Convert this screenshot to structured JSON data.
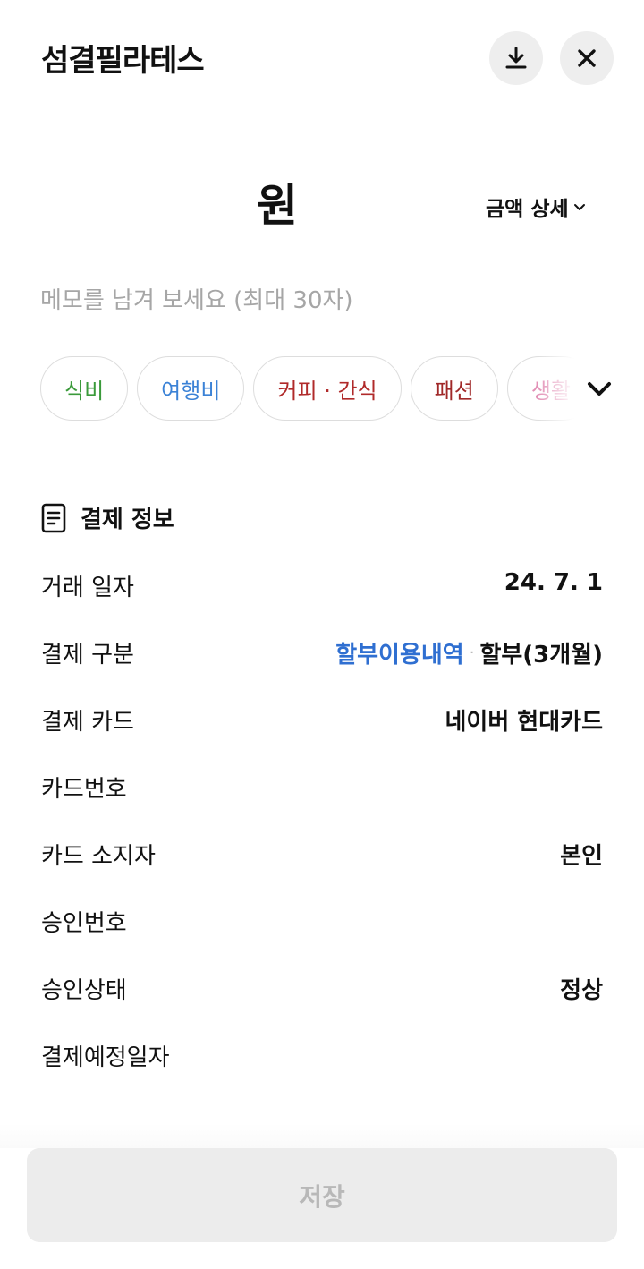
{
  "header": {
    "title": "섬결필라테스",
    "download_icon": "download-icon",
    "close_icon": "close-icon"
  },
  "amount": {
    "value_text": "원",
    "detail_label": "금액 상세"
  },
  "memo": {
    "placeholder": "메모를 남겨 보세요 (최대 30자)",
    "value": ""
  },
  "categories": [
    {
      "label": "식비",
      "color": "#3a9a3a"
    },
    {
      "label": "여행비",
      "color": "#3b82d6"
    },
    {
      "label": "커피 · 간식",
      "color": "#b02a2a"
    },
    {
      "label": "패션",
      "color": "#a02828"
    },
    {
      "label": "생활",
      "color": "#e28fb5"
    }
  ],
  "payment_info": {
    "section_title": "결제 정보",
    "rows": {
      "date": {
        "label": "거래 일자",
        "value": "24. 7. 1"
      },
      "type": {
        "label": "결제 구분",
        "link": "할부이용내역",
        "separator": "·",
        "value": "할부(3개월)"
      },
      "card": {
        "label": "결제 카드",
        "value": "네이버 현대카드"
      },
      "card_number": {
        "label": "카드번호",
        "value": ""
      },
      "card_holder": {
        "label": "카드 소지자",
        "value": "본인"
      },
      "approval_number": {
        "label": "승인번호",
        "value": ""
      },
      "approval_status": {
        "label": "승인상태",
        "value": "정상"
      },
      "scheduled_date": {
        "label": "결제예정일자",
        "value": ""
      }
    }
  },
  "footer": {
    "save_label": "저장"
  },
  "colors": {
    "link_blue": "#2f6fd1",
    "disabled_text": "#b8b8b8",
    "disabled_bg": "#ececec"
  }
}
